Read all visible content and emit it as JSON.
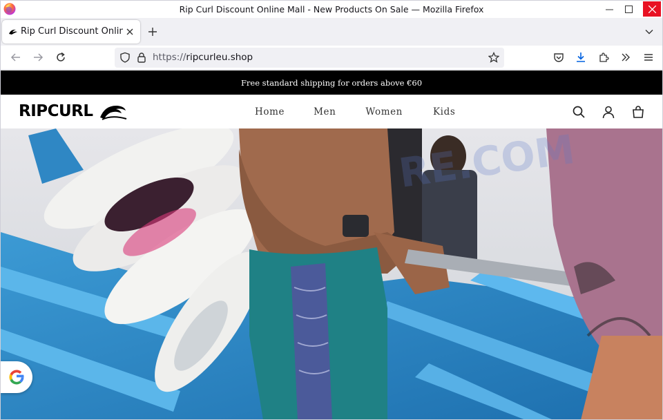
{
  "window": {
    "title": "Rip Curl Discount Online Mall - New Products On Sale — Mozilla Firefox"
  },
  "tab": {
    "label": "Rip Curl Discount Online Mall - New Products On Sale"
  },
  "urlbar": {
    "scheme": "https://",
    "host": "ripcurleu.shop"
  },
  "site": {
    "announcement": "Free standard shipping for orders above €60",
    "logo_text": "RIPCURL",
    "nav": [
      "Home",
      "Men",
      "Women",
      "Kids"
    ]
  },
  "icons": {
    "browser": [
      "firefox-logo-icon",
      "back-icon",
      "forward-icon",
      "reload-icon",
      "shield-icon",
      "lock-icon",
      "bookmark-star-icon",
      "pocket-icon",
      "download-icon",
      "extensions-icon",
      "overflow-icon",
      "menu-icon"
    ],
    "site": [
      "search-icon",
      "account-icon",
      "cart-icon",
      "google-icon"
    ]
  },
  "colors": {
    "announcement_bg": "#000000",
    "download_accent": "#0060df",
    "close_button": "#e81123",
    "hero_boat": "#3a97cf"
  }
}
